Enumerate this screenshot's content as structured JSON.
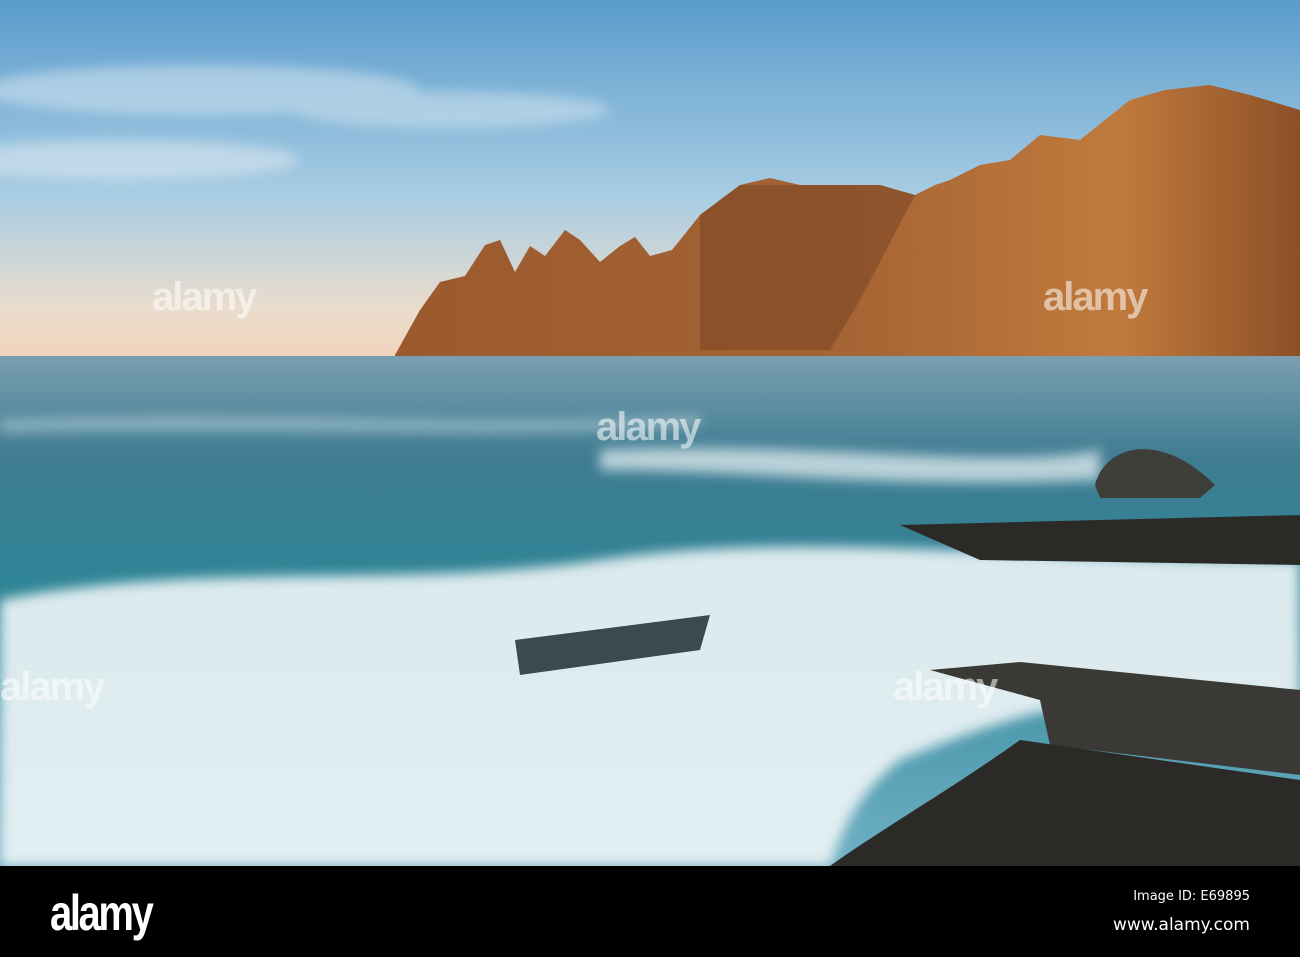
{
  "photo": {
    "subject": "Coastal mountains at sunset with surf over rocks",
    "colors": {
      "sky_top": "#5f9fd0",
      "sky_horizon": "#f1d9c3",
      "mountain": "#b06a33",
      "sea": "#3c8aa0",
      "foam": "#e8f1f4",
      "rock": "#2a2a28"
    }
  },
  "watermark": {
    "text": "alamy"
  },
  "footer": {
    "logo": "alamy",
    "image_id": "Image ID: E69895",
    "website": "www.alamy.com"
  }
}
